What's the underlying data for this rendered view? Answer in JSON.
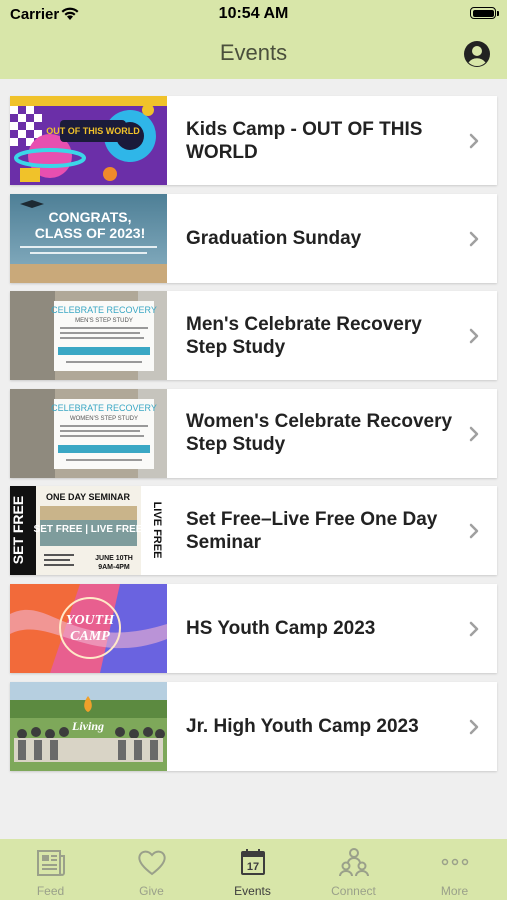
{
  "status": {
    "carrier": "Carrier",
    "time": "10:54 AM"
  },
  "header": {
    "title": "Events"
  },
  "events": [
    {
      "title": "Kids Camp - OUT OF THIS WORLD",
      "thumb_text": "OUT OF THIS WORLD"
    },
    {
      "title": "Graduation Sunday",
      "thumb_text": "CONGRATS, CLASS OF 2023!"
    },
    {
      "title": "Men's Celebrate Recovery Step Study",
      "thumb_text": "CELEBRATE RECOVERY",
      "thumb_subtext": "MEN'S STEP STUDY"
    },
    {
      "title": "Women's Celebrate Recovery Step Study",
      "thumb_text": "CELEBRATE RECOVERY",
      "thumb_subtext": "WOMEN'S STEP STUDY"
    },
    {
      "title": "Set Free–Live Free One Day Seminar",
      "thumb_text": "ONE DAY SEMINAR",
      "thumb_subtext": "JUNE 10TH 9AM-4PM"
    },
    {
      "title": "HS Youth Camp 2023",
      "thumb_text": "YOUTH CAMP"
    },
    {
      "title": "Jr. High Youth Camp 2023",
      "thumb_text": "Living"
    }
  ],
  "tabs": [
    {
      "label": "Feed",
      "icon": "newspaper-icon"
    },
    {
      "label": "Give",
      "icon": "heart-icon"
    },
    {
      "label": "Events",
      "icon": "calendar-icon",
      "calendar_day": "17"
    },
    {
      "label": "Connect",
      "icon": "people-icon"
    },
    {
      "label": "More",
      "icon": "ellipsis-icon"
    }
  ],
  "colors": {
    "header": "#d8e6a9",
    "background": "#efefef",
    "active_tab": "#3d3d3d",
    "inactive_tab": "#9aa08a"
  }
}
